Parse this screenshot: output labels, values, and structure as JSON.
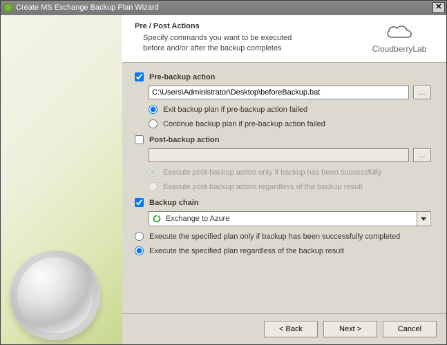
{
  "title": "Create MS Exchange Backup Plan Wizard",
  "header": {
    "title": "Pre / Post Actions",
    "subtitle": "Specify commands you want to be executed before and/or after the backup completes",
    "brand": "CloudberryLab"
  },
  "preBackup": {
    "label": "Pre-backup action",
    "checked": true,
    "path": "C:\\Users\\Administrator\\Desktop\\beforeBackup.bat",
    "browse": "...",
    "radio1": "Exit backup plan if pre-backup action failed",
    "radio2": "Continue backup plan if pre-backup action failed",
    "selected": "exit"
  },
  "postBackup": {
    "label": "Post-backup action",
    "checked": false,
    "path": "",
    "browse": "...",
    "radio1": "Execute post-backup action only if backup has been successfully",
    "radio2": "Execute post-backup action regardless of the backup result"
  },
  "backupChain": {
    "label": "Backup chain",
    "checked": true,
    "selected": "Exchange to Azure",
    "radio1": "Execute the specified plan only if backup has been successfully completed",
    "radio2": "Execute the specified plan regardless of the backup result",
    "selectedRadio": "regardless"
  },
  "buttons": {
    "back": "< Back",
    "next": "Next >",
    "cancel": "Cancel"
  }
}
